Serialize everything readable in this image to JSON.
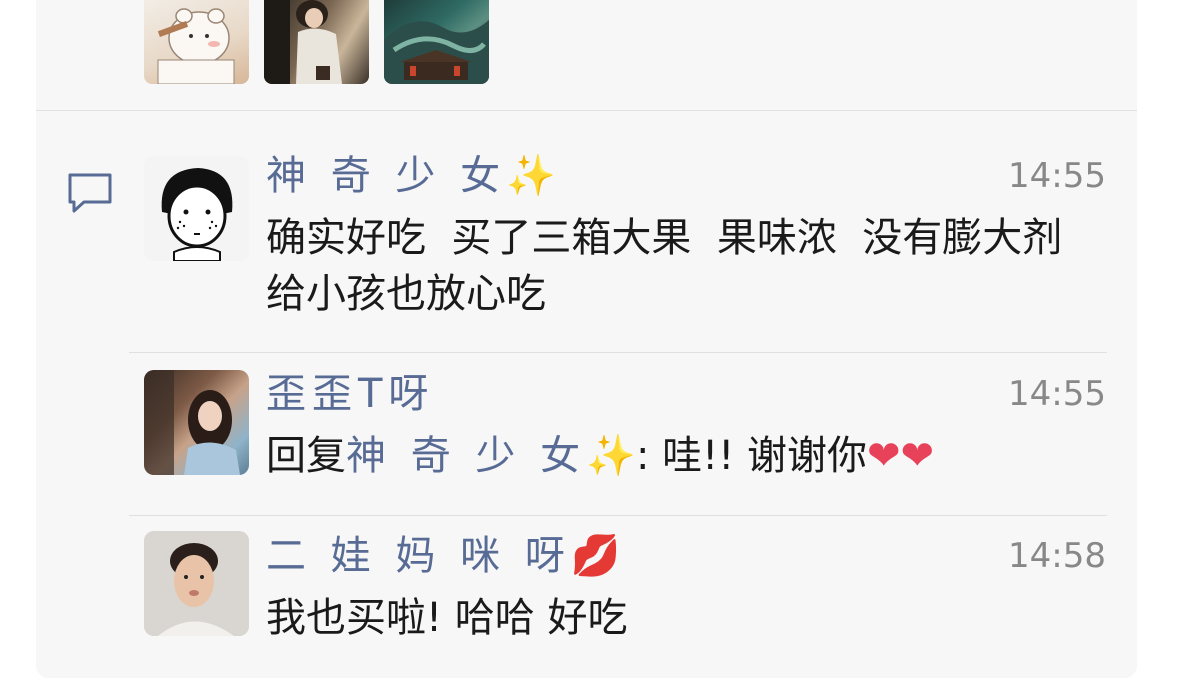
{
  "comments": [
    {
      "name": "神 奇 少 女",
      "name_emoji": "✨",
      "time": "14:55",
      "content": "确实好吃  买了三箱大果  果味浓  没有膨大剂  给小孩也放心吃"
    },
    {
      "name": "歪歪T呀",
      "time": "14:55",
      "reply_prefix": "回复",
      "reply_to": "神 奇 少 女",
      "reply_emoji": "✨",
      "content": ": 哇!! 谢谢你",
      "hearts": "❤❤"
    },
    {
      "name": "二 娃 妈 咪 呀",
      "name_emoji": "💋",
      "time": "14:58",
      "content": "我也买啦! 哈哈 好吃"
    }
  ],
  "icons": {
    "comment": "comment-bubble-icon"
  },
  "colors": {
    "name": "#576b95",
    "time": "#888888",
    "panel_bg": "#f7f7f7",
    "text": "#1a1a1a"
  }
}
